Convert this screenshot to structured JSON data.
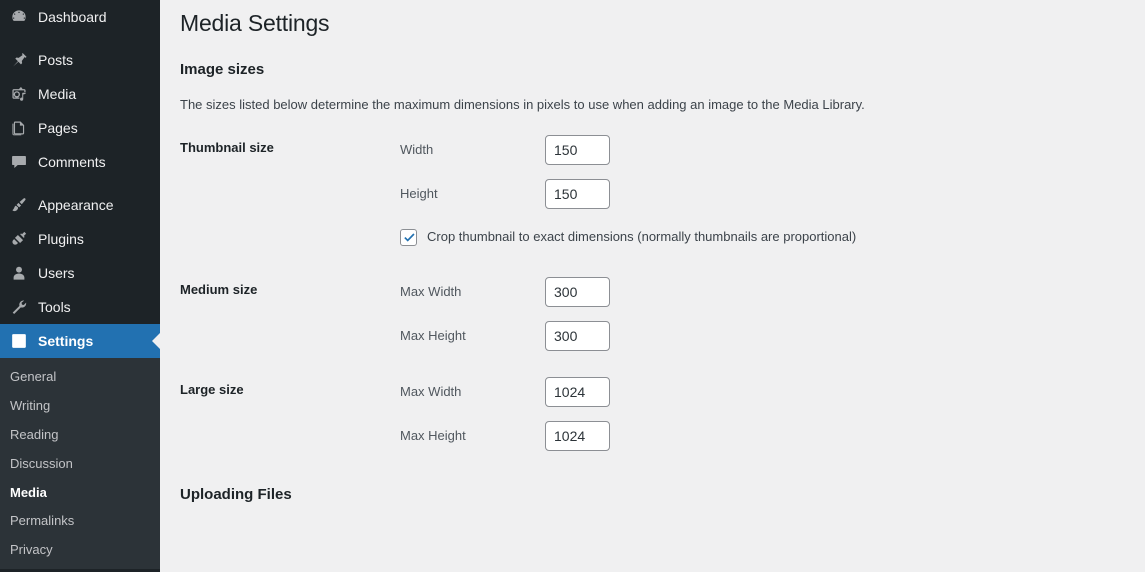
{
  "sidebar": {
    "groups": [
      {
        "items": [
          {
            "label": "Dashboard",
            "icon": "dashboard-icon",
            "current": false
          }
        ]
      },
      {
        "items": [
          {
            "label": "Posts",
            "icon": "pin-icon",
            "current": false
          },
          {
            "label": "Media",
            "icon": "media-icon",
            "current": false
          },
          {
            "label": "Pages",
            "icon": "pages-icon",
            "current": false
          },
          {
            "label": "Comments",
            "icon": "comment-icon",
            "current": false
          }
        ]
      },
      {
        "items": [
          {
            "label": "Appearance",
            "icon": "paintbrush-icon",
            "current": false
          },
          {
            "label": "Plugins",
            "icon": "plugin-icon",
            "current": false
          },
          {
            "label": "Users",
            "icon": "user-icon",
            "current": false
          },
          {
            "label": "Tools",
            "icon": "wrench-icon",
            "current": false
          },
          {
            "label": "Settings",
            "icon": "sliders-icon",
            "current": true
          }
        ]
      }
    ],
    "submenu": [
      {
        "label": "General",
        "current": false
      },
      {
        "label": "Writing",
        "current": false
      },
      {
        "label": "Reading",
        "current": false
      },
      {
        "label": "Discussion",
        "current": false
      },
      {
        "label": "Media",
        "current": true
      },
      {
        "label": "Permalinks",
        "current": false
      },
      {
        "label": "Privacy",
        "current": false
      }
    ],
    "colors": {
      "background": "#1d2327",
      "submenu_background": "#2c3338",
      "highlight": "#2271b1",
      "text": "#f0f0f1",
      "icon": "#a7aaad"
    }
  },
  "main": {
    "page_title": "Media Settings",
    "image_sizes": {
      "heading": "Image sizes",
      "description": "The sizes listed below determine the maximum dimensions in pixels to use when adding an image to the Media Library.",
      "rows": [
        {
          "label": "Thumbnail size",
          "fields": [
            {
              "label": "Width",
              "value": "150"
            },
            {
              "label": "Height",
              "value": "150"
            }
          ],
          "checkbox": {
            "label": "Crop thumbnail to exact dimensions (normally thumbnails are proportional)",
            "checked": true
          }
        },
        {
          "label": "Medium size",
          "fields": [
            {
              "label": "Max Width",
              "value": "300"
            },
            {
              "label": "Max Height",
              "value": "300"
            }
          ]
        },
        {
          "label": "Large size",
          "fields": [
            {
              "label": "Max Width",
              "value": "1024"
            },
            {
              "label": "Max Height",
              "value": "1024"
            }
          ]
        }
      ]
    },
    "uploading_files": {
      "heading": "Uploading Files"
    },
    "colors": {
      "background": "#f0f0f1",
      "title": "#1d2327",
      "label": "#50575e",
      "input_border": "#8c8f94",
      "checkbox_accent": "#2271b1"
    }
  }
}
